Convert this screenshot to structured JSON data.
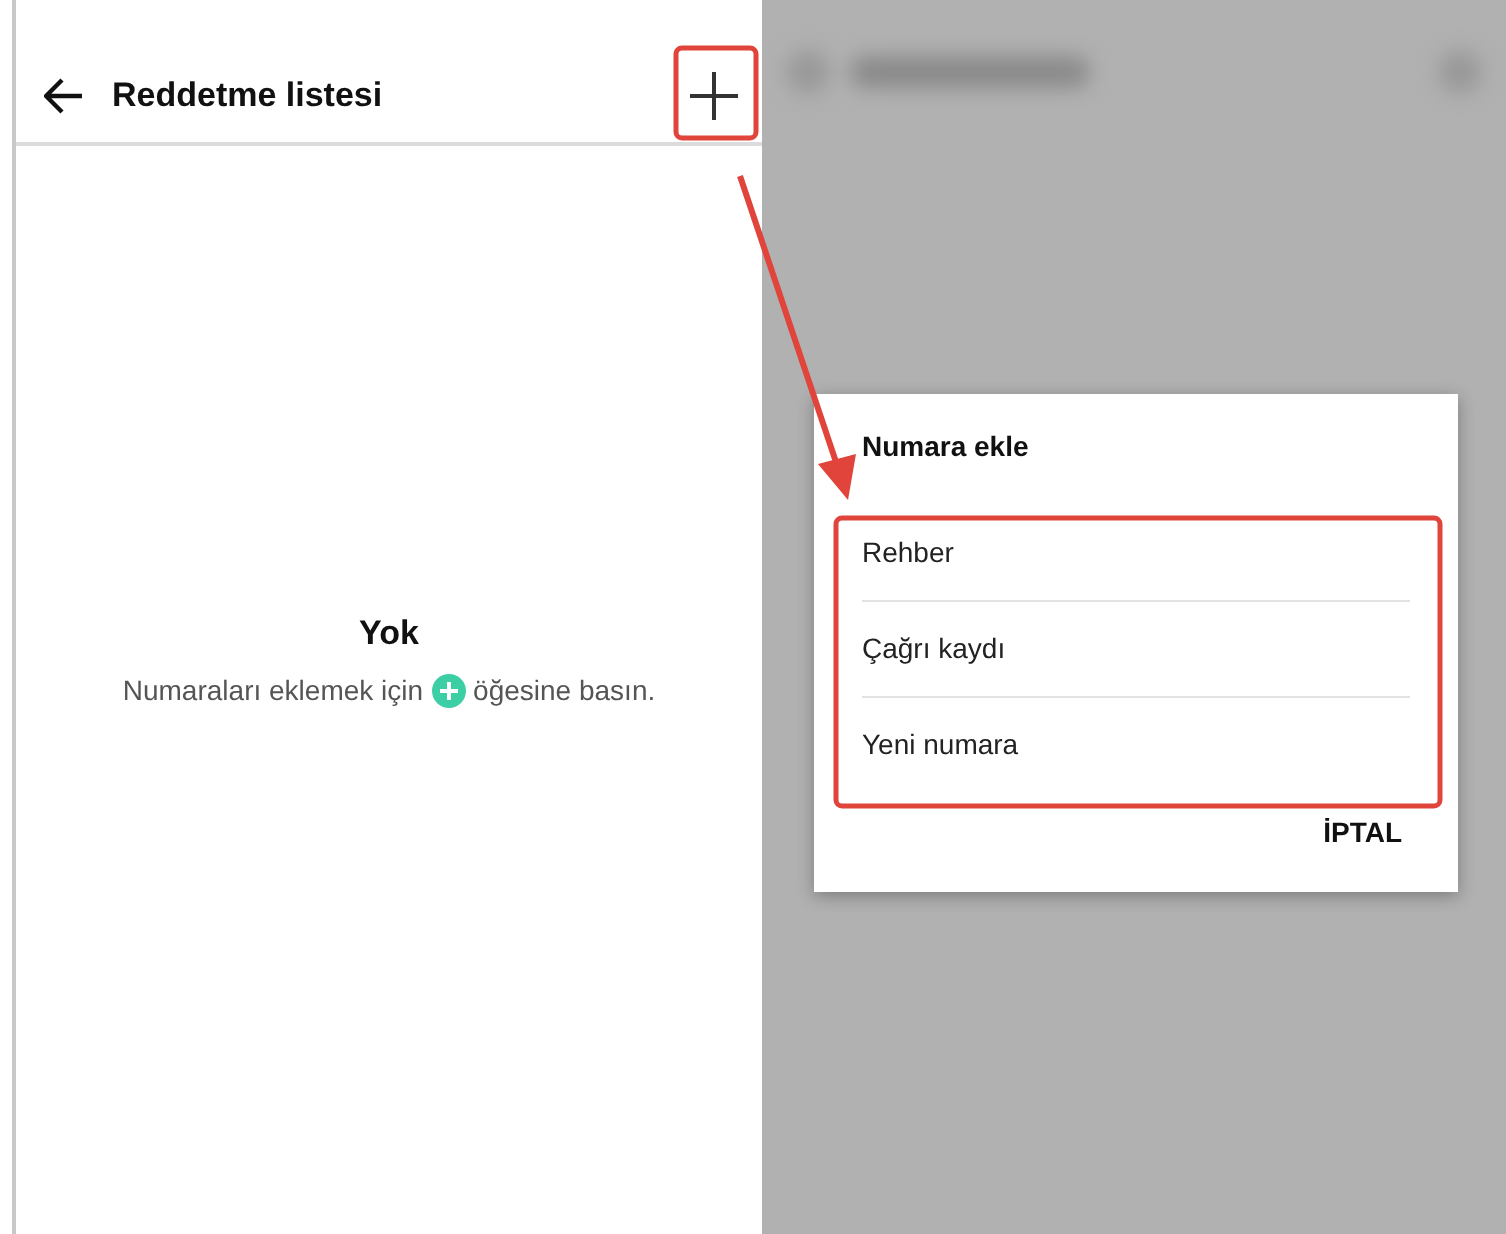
{
  "header": {
    "title": "Reddetme listesi"
  },
  "empty_state": {
    "title": "Yok",
    "message_before": "Numaraları eklemek için",
    "message_after": "öğesine basın."
  },
  "dialog": {
    "title": "Numara ekle",
    "options": [
      {
        "label": "Rehber"
      },
      {
        "label": "Çağrı kaydı"
      },
      {
        "label": "Yeni numara"
      }
    ],
    "cancel": "İPTAL"
  }
}
